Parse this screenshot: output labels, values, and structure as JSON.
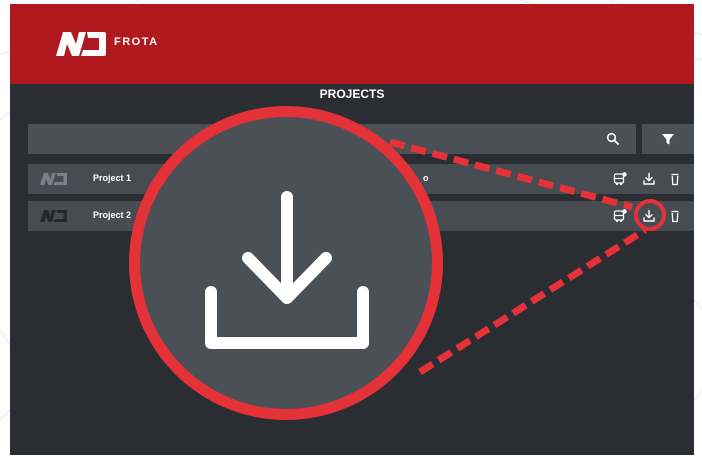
{
  "app": {
    "brand": "FROTA",
    "page_title": "PROJECTS"
  },
  "search": {
    "value": "",
    "placeholder": ""
  },
  "projects": [
    {
      "name": "Project 1",
      "extra": "o"
    },
    {
      "name": "Project 2",
      "extra": ""
    }
  ],
  "icons": {
    "logo": "nd-logo-icon",
    "search": "search-icon",
    "filter": "filter-icon",
    "vehicle": "bus-icon",
    "download": "download-icon",
    "delete": "trash-icon"
  },
  "colors": {
    "header": "#b0191d",
    "background": "#2a2d31",
    "row": "#474c53",
    "highlight": "#e53238",
    "zoom_fill": "#4b5057"
  }
}
